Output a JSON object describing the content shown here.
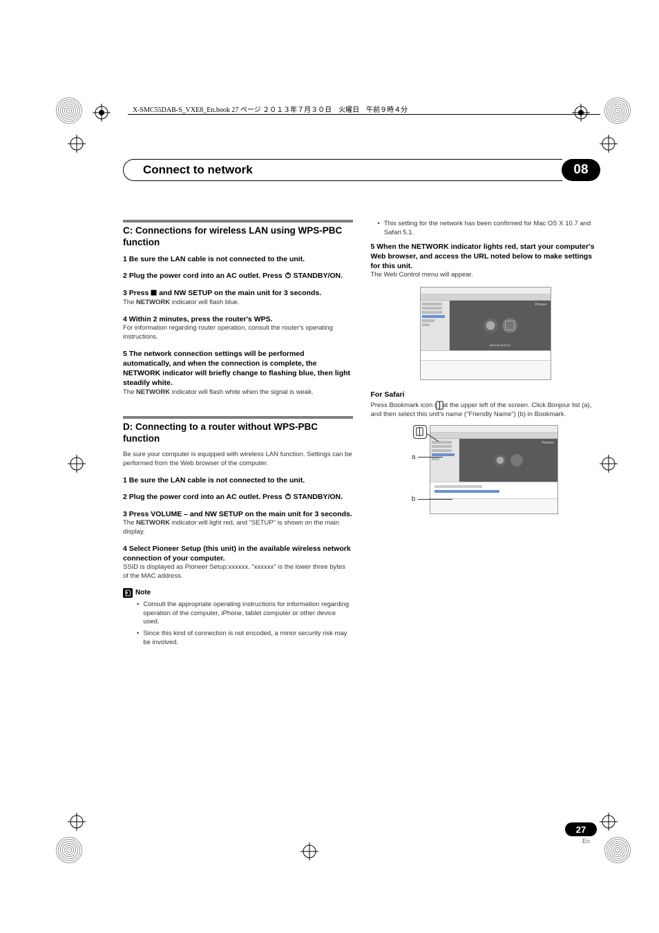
{
  "header_file_info": "X-SMC55DAB-S_VXE8_En.book  27 ページ  ２０１３年７月３０日　火曜日　午前９時４分",
  "chapter": {
    "title": "Connect to network",
    "number": "08"
  },
  "sectionC": {
    "title": "C: Connections for wireless LAN using WPS-PBC function",
    "step1": "1     Be sure the LAN cable is not connected to the unit.",
    "step2a": "2     Plug the power cord into an AC outlet. Press ",
    "step2b": " STANDBY/ON.",
    "step3a": "3     Press ",
    "step3b": " and NW SETUP on the main unit for 3 seconds.",
    "step3_body_a": "The ",
    "step3_body_b": "NETWORK",
    "step3_body_c": " indicator will flash blue.",
    "step4": "4     Within 2 minutes, press the router's WPS.",
    "step4_body": "For information regarding router operation, consult the router's operating instructions.",
    "step5": "5     The network connection settings will be performed automatically, and when the connection is complete, the NETWORK indicator will briefly change to flashing blue, then light steadily white.",
    "step5_body_a": "The ",
    "step5_body_b": "NETWORK",
    "step5_body_c": " indicator will flash white when the signal is weak."
  },
  "sectionD": {
    "title": "D: Connecting to a router without WPS-PBC function",
    "intro": "Be sure your computer is equipped with wireless LAN function. Settings can be performed from the Web browser of the computer.",
    "step1": "1     Be sure the LAN cable is not connected to the unit.",
    "step2a": "2     Plug the power cord into an AC outlet. Press ",
    "step2b": " STANDBY/ON.",
    "step3": "3     Press VOLUME – and NW SETUP on the main unit for 3 seconds.",
    "step3_body_a": "The ",
    "step3_body_b": "NETWORK",
    "step3_body_c": " indicator will light red, and \"SETUP\" is shown on the main display.",
    "step4": "4     Select Pioneer Setup (this unit) in the available wireless network connection of your computer.",
    "step4_body": "SSID is displayed as Pioneer Setup:xxxxxx. \"xxxxxx\" is the lower three bytes of the MAC address.",
    "note_label": "Note",
    "note1": "Consult the appropriate operating instructions for information regarding operation of the computer, iPhone, tablet computer or other device used.",
    "note2": "Since this kind of connection is not encoded, a minor security risk may be involved."
  },
  "rightCol": {
    "bullet1": "This setting for the network has been confirmed for Mac OS X 10.7 and Safari 5.1.",
    "step5": "5     When the NETWORK indicator lights red, start your computer's Web browser, and access the URL noted below to make settings for this unit.",
    "step5_body": "The Web Control menu will appear.",
    "safari_title": "For Safari",
    "safari_body": "Press Bookmark icon (       ) at the upper left of the screen. Click Bonjour list (a), and then select this unit's name (\"Friendly Name\") (b) in Bookmark.",
    "mark_a": "a",
    "mark_b": "b"
  },
  "screenshot": {
    "pioneer_label": "Pioneer",
    "manual_btn": "Manual Bottom"
  },
  "footer": {
    "page": "27",
    "lang": "En"
  }
}
